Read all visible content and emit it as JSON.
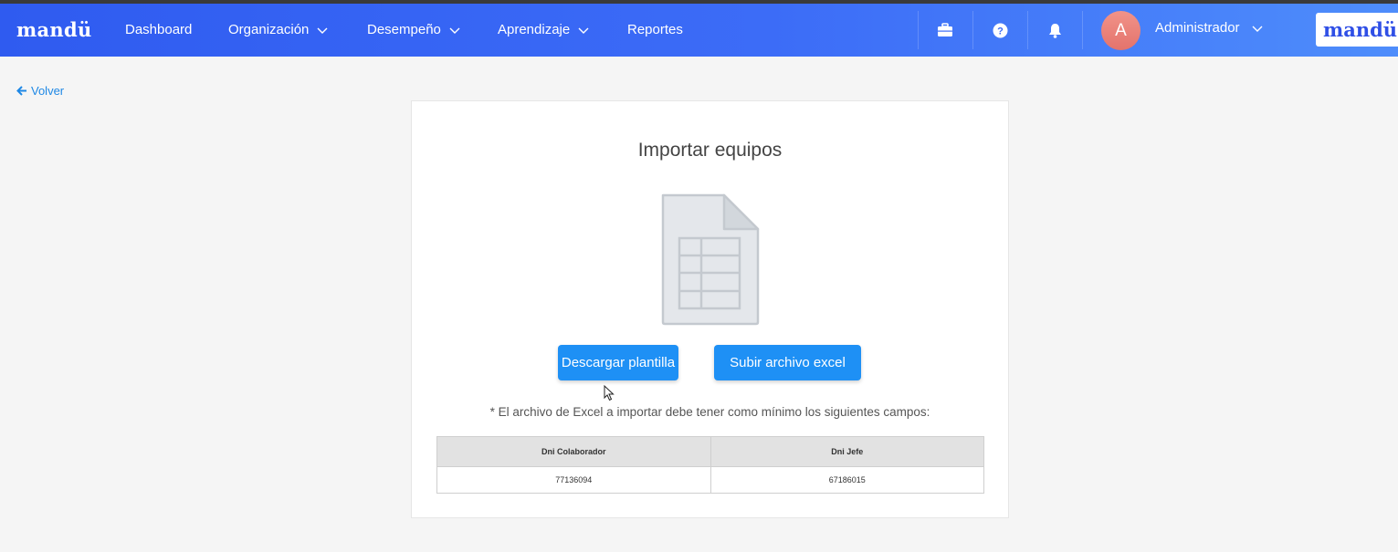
{
  "app": {
    "brand": "mandü",
    "logo_text": "mandü"
  },
  "nav": {
    "items": [
      {
        "label": "Dashboard",
        "has_dropdown": false
      },
      {
        "label": "Organización",
        "has_dropdown": true
      },
      {
        "label": "Desempeño",
        "has_dropdown": true
      },
      {
        "label": "Aprendizaje",
        "has_dropdown": true
      },
      {
        "label": "Reportes",
        "has_dropdown": false
      }
    ],
    "icons": [
      "briefcase-icon",
      "help-icon",
      "bell-icon"
    ],
    "user": {
      "avatar_initial": "A",
      "name": "Administrador"
    }
  },
  "back": {
    "label": "Volver"
  },
  "import": {
    "title": "Importar equipos",
    "download_label": "Descargar plantilla",
    "upload_label": "Subir archivo excel",
    "note": "* El archivo de Excel a importar debe tener como mínimo los siguientes campos:",
    "columns": [
      "Dni Colaborador",
      "Dni Jefe"
    ],
    "rows": [
      [
        "77136094",
        "67186015"
      ]
    ]
  },
  "colors": {
    "navbar_start": "#2f5bf0",
    "navbar_end": "#4e8dfb",
    "primary_button": "#1e90f5",
    "link": "#1e88e5",
    "avatar": "#e4736c"
  }
}
